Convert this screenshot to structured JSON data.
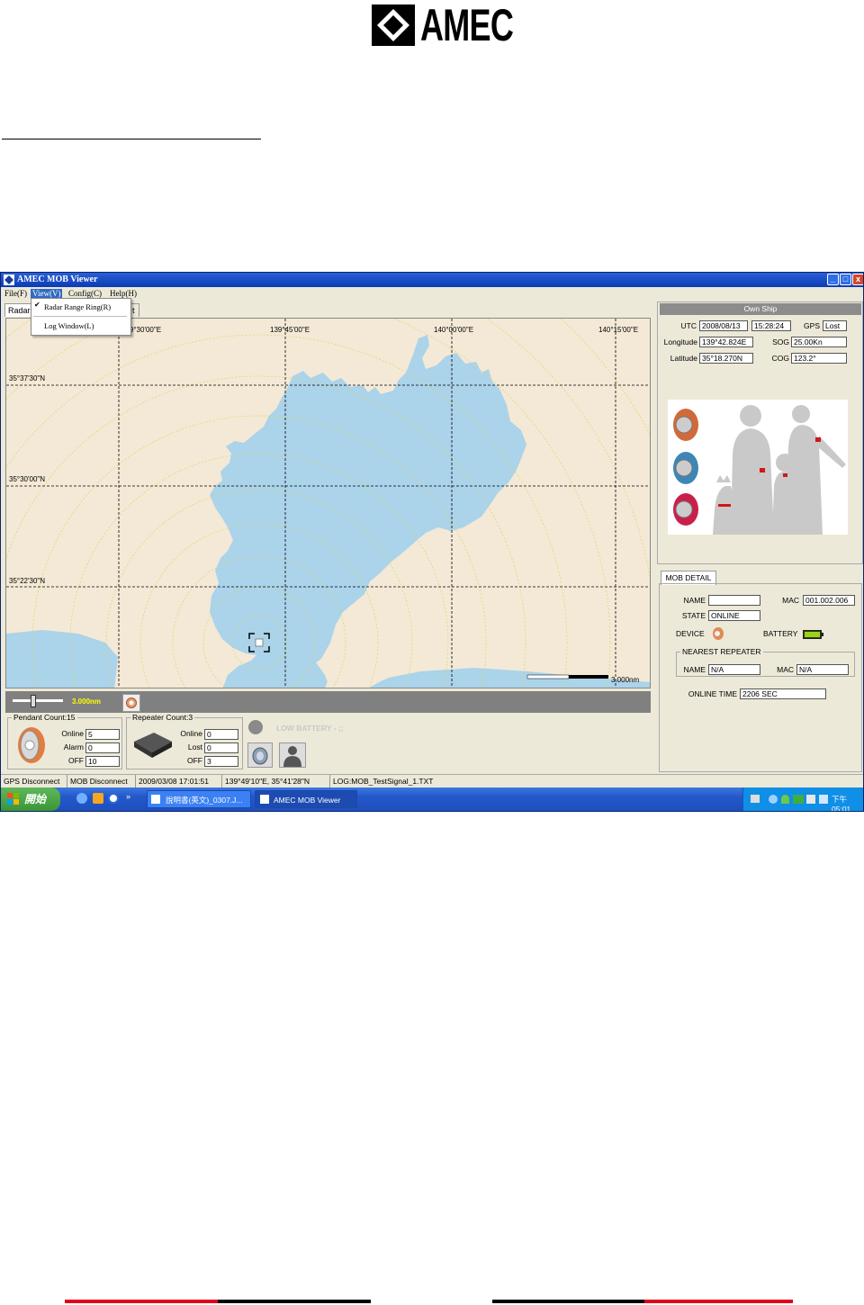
{
  "logo": {
    "text": "AMEC"
  },
  "window": {
    "title": "AMEC MOB Viewer",
    "buttons": {
      "min": "_",
      "max": "□",
      "close": "x"
    }
  },
  "menu": {
    "file": "File(F)",
    "view": "View(V)",
    "config": "Config(C)",
    "help": "Help(H)",
    "view_items": [
      "Radar Range Ring(R)",
      "Log Window(L)"
    ],
    "check": "✔"
  },
  "tabs": {
    "radar": "Radar",
    "other": "t"
  },
  "map": {
    "lon_labels": [
      "139°30'00\"E",
      "139°45'00\"E",
      "140°00'00\"E",
      "140°15'00\"E"
    ],
    "lat_labels": [
      "35°37'30\"N",
      "35°30'00\"N",
      "35°22'30\"N"
    ],
    "scale_label": "3.000nm",
    "colors": {
      "land": "#f3e9d6",
      "water": "#abd3ea",
      "ring": "#d8d86a"
    }
  },
  "zoom": {
    "label": "3.000nm"
  },
  "pendant": {
    "title": "Pendant Count:15",
    "online_label": "Online",
    "online": "5",
    "alarm_label": "Alarm",
    "alarm": "0",
    "off_label": "OFF",
    "off": "10"
  },
  "repeater": {
    "title": "Repeater Count:3",
    "online_label": "Online",
    "online": "0",
    "lost_label": "Lost",
    "lost": "0",
    "off_label": "OFF",
    "off": "3"
  },
  "low_battery": "LOW BATTERY - ;;",
  "own_ship": {
    "header": "Own Ship",
    "utc_label": "UTC",
    "utc_date": "2008/08/13",
    "utc_time": "15:28:24",
    "gps_label": "GPS",
    "gps": "Lost",
    "lon_label": "Longitude",
    "lon": "139°42.824E",
    "sog_label": "SOG",
    "sog": "25.00Kn",
    "lat_label": "Latitude",
    "lat": "35°18.270N",
    "cog_label": "COG",
    "cog": "123.2°"
  },
  "mob_detail": {
    "tab": "MOB DETAIL",
    "name_label": "NAME",
    "name": "",
    "mac_label": "MAC",
    "mac": "001.002.006",
    "state_label": "STATE",
    "state": "ONLINE",
    "device_label": "DEVICE",
    "battery_label": "BATTERY",
    "nearest_title": "NEAREST REPEATER",
    "rep_name_label": "NAME",
    "rep_name": "N/A",
    "rep_mac_label": "MAC",
    "rep_mac": "N/A",
    "online_time_label": "ONLINE TIME",
    "online_time": "2206 SEC"
  },
  "status": [
    "GPS Disconnect",
    "MOB Disconnect",
    "2009/03/08 17:01:51",
    "139°49'10\"E, 35°41'28\"N",
    "LOG:MOB_TestSignal_1.TXT"
  ],
  "taskbar": {
    "start": "開始",
    "quick": "»",
    "task1": "說明書(英文)_0307.J...",
    "task2": "AMEC MOB Viewer",
    "clock": "下午 05:01"
  }
}
